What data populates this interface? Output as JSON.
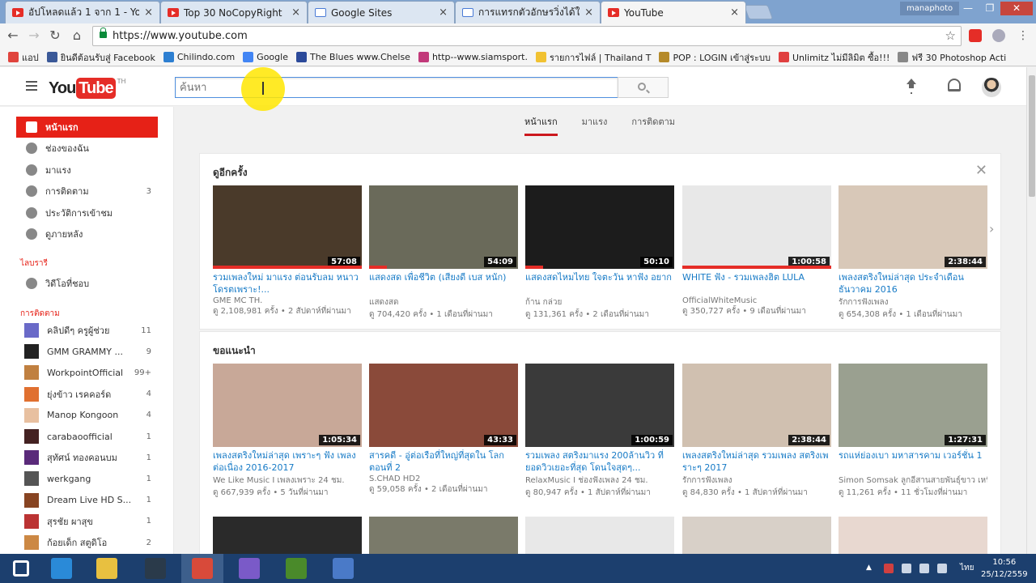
{
  "browser": {
    "tabs": [
      {
        "title": "อัปโหลดแล้ว 1 จาก 1 - You",
        "icon": "youtube-favicon",
        "active": false
      },
      {
        "title": "Top 30 NoCopyRight",
        "icon": "youtube-favicon",
        "active": false
      },
      {
        "title": "Google Sites",
        "icon": "google-sites-favicon",
        "active": false
      },
      {
        "title": "การแทรกตัวอักษรวิ่งได้ในเว็บ",
        "icon": "google-sites-favicon",
        "active": false
      },
      {
        "title": "YouTube",
        "icon": "youtube-favicon",
        "active": true
      }
    ],
    "tab_close": "×",
    "window_user": "manaphoto",
    "url": "https://www.youtube.com",
    "bookmarks": [
      {
        "label": "แอป",
        "color": "#e0443d"
      },
      {
        "label": "ยินดีต้อนรับสู่ Facebook",
        "color": "#3b5998"
      },
      {
        "label": "Chilindo.com",
        "color": "#2d7fd1"
      },
      {
        "label": "Google",
        "color": "#4285f4"
      },
      {
        "label": "The Blues www.Chelse",
        "color": "#2c4a9a"
      },
      {
        "label": "http--www.siamsport.",
        "color": "#c23a7a"
      },
      {
        "label": "รายการไฟล์ | Thailand T",
        "color": "#f1c232"
      },
      {
        "label": "POP : LOGIN เข้าสู่ระบบ",
        "color": "#b58a2a"
      },
      {
        "label": "Unlimitz ไม่มีลิมิต ซื้อ!!!",
        "color": "#e04040"
      },
      {
        "label": "ฟรี 30 Photoshop Acti",
        "color": "#888888"
      }
    ]
  },
  "youtube": {
    "country": "TH",
    "search_placeholder": "ค้นหา",
    "nav": [
      {
        "label": "หน้าแรก",
        "icon": "home-icon",
        "active": true,
        "count": ""
      },
      {
        "label": "ช่องของฉัน",
        "icon": "my-channel-icon",
        "active": false,
        "count": ""
      },
      {
        "label": "มาแรง",
        "icon": "trending-icon",
        "active": false,
        "count": ""
      },
      {
        "label": "การติดตาม",
        "icon": "subscriptions-icon",
        "active": false,
        "count": "3"
      },
      {
        "label": "ประวัติการเข้าชม",
        "icon": "history-icon",
        "active": false,
        "count": ""
      },
      {
        "label": "ดูภายหลัง",
        "icon": "watch-later-icon",
        "active": false,
        "count": ""
      }
    ],
    "library_heading": "ไลบรารี",
    "library": [
      {
        "label": "วิดีโอที่ชอบ",
        "icon": "thumbs-up-icon"
      }
    ],
    "subs_heading": "การติดตาม",
    "subscriptions": [
      {
        "name": "คลิปดีๆ ครูผู้ช่วย",
        "count": "11",
        "color": "#6a6ac8"
      },
      {
        "name": "GMM GRAMMY ...",
        "count": "9",
        "color": "#222222"
      },
      {
        "name": "WorkpointOfficial",
        "count": "99+",
        "color": "#c08040"
      },
      {
        "name": "ยุ่งข้าว เรคคอร์ด",
        "count": "4",
        "color": "#e07030"
      },
      {
        "name": "Manop Kongoon",
        "count": "4",
        "color": "#e8c0a0"
      },
      {
        "name": "carabaoofficial",
        "count": "1",
        "color": "#442222"
      },
      {
        "name": "สุทัศน์ ทองคอนบม",
        "count": "1",
        "color": "#5a2a7a"
      },
      {
        "name": "werkgang",
        "count": "1",
        "color": "#555555"
      },
      {
        "name": "Dream Live HD S...",
        "count": "1",
        "color": "#884422"
      },
      {
        "name": "สุรชัย ผาสุข",
        "count": "1",
        "color": "#bb3333"
      },
      {
        "name": "ก้อยเด็ก สตูดิโอ",
        "count": "2",
        "color": "#cc8844"
      }
    ],
    "top_tabs": [
      {
        "label": "หน้าแรก",
        "active": true
      },
      {
        "label": "มาแรง",
        "active": false
      },
      {
        "label": "การติดตาม",
        "active": false
      }
    ],
    "shelf1": {
      "title": "ดูอีกครั้ง",
      "close": "✕",
      "videos": [
        {
          "title": "รวมเพลงใหม่ มาแรง ต่อนรับลม หนาว โดรตเพราะ!...",
          "channel": "GME MC TH.",
          "meta": "ดู 2,108,981 ครั้ง • 2 สัปดาห์ที่ผ่านมา",
          "duration": "57:08",
          "watched": 1.0,
          "bg": "#4a3a2a"
        },
        {
          "title": "แสดงสด เพื่อชีวิต (เสียงดี เบส หนัก)",
          "channel": "แสดงสด",
          "meta": "ดู 704,420 ครั้ง • 1 เดือนที่ผ่านมา",
          "duration": "54:09",
          "watched": 0.12,
          "bg": "#6a6a5a"
        },
        {
          "title": "แสดงสดไหมไทย ใจตะวัน หาฟัง อยาก",
          "channel": "ก้าน กล่วย",
          "meta": "ดู 131,361 ครั้ง • 2 เดือนที่ผ่านมา",
          "duration": "50:10",
          "watched": 0.12,
          "bg": "#1c1c1c"
        },
        {
          "title": "WHITE ฟัง - รวมเพลงฮิต LULA",
          "channel": "OfficialWhiteMusic",
          "meta": "ดู 350,727 ครั้ง • 9 เดือนที่ผ่านมา",
          "duration": "1:00:58",
          "watched": 1.0,
          "bg": "#e8e8e8"
        },
        {
          "title": "เพลงสตริงใหม่ล่าสุด ประจำเดือน ธันวาคม 2016",
          "channel": "รักการฟังเพลง",
          "meta": "ดู 654,308 ครั้ง • 1 เดือนที่ผ่านมา",
          "duration": "2:38:44",
          "watched": 0.0,
          "bg": "#d8c8b8"
        }
      ]
    },
    "shelf2": {
      "title": "ขอแนะนำ",
      "videos": [
        {
          "title": "เพลงสตริงใหม่ล่าสุด เพราะๆ ฟัง เพลงต่อเนื่อง 2016-2017",
          "channel": "We Like Music I เพลงเพราะ 24 ชม.",
          "meta": "ดู 667,939 ครั้ง • 5 วันที่ผ่านมา",
          "duration": "1:05:34",
          "bg": "#c8a898"
        },
        {
          "title": "สารคดี - อู่ต่อเรือที่ใหญ่ที่สุดใน โลก ตอนที่ 2",
          "channel": "S.CHAD HD2",
          "meta": "ดู 59,058 ครั้ง • 2 เดือนที่ผ่านมา",
          "duration": "43:33",
          "bg": "#8a4a3a"
        },
        {
          "title": "รวมเพลง สตริงมาแรง 200ล้านวิว ที่ยอดวิวเยอะที่สุด โดนใจสุดๆ...",
          "channel": "RelaxMusic I ช่องฟังเพลง 24 ชม.",
          "meta": "ดู 80,947 ครั้ง • 1 สัปดาห์ที่ผ่านมา",
          "duration": "1:00:59",
          "bg": "#3a3a3a"
        },
        {
          "title": "เพลงสตริงใหม่ล่าสุด รวมเพลง สตริงเพราะๆ 2017",
          "channel": "รักการฟังเพลง",
          "meta": "ดู 84,830 ครั้ง • 1 สัปดาห์ที่ผ่านมา",
          "duration": "2:38:44",
          "bg": "#d0c0b0"
        },
        {
          "title": "รถแห่ย่องเบา มหาสารคาม เวอร์ชั่น 1",
          "channel": "Simon Somsak ลูกอีสานสายพันธุ์ขาว เหนียว",
          "meta": "ดู 11,261 ครั้ง • 11 ชั่วโมงที่ผ่านมา",
          "duration": "1:27:31",
          "bg": "#9aa090"
        }
      ]
    },
    "row3_bgs": [
      "#2a2a2a",
      "#7a7a6a",
      "#e8e8e8",
      "#d8d0c8",
      "#e8d8d0"
    ]
  },
  "taskbar": {
    "apps": [
      {
        "name": "start-button",
        "color": "#ffffff"
      },
      {
        "name": "internet-explorer-icon",
        "color": "#2a8ad8"
      },
      {
        "name": "file-explorer-icon",
        "color": "#e8c040"
      },
      {
        "name": "lightroom-icon",
        "color": "#2a3a4a"
      },
      {
        "name": "chrome-icon",
        "color": "#d84a3a"
      },
      {
        "name": "media-player-icon",
        "color": "#7a5ac8"
      },
      {
        "name": "dreamweaver-icon",
        "color": "#4a8a2a"
      },
      {
        "name": "app-icon",
        "color": "#4a7ac8"
      }
    ],
    "lang": "ไทย",
    "time": "10:56",
    "date": "25/12/2559"
  }
}
